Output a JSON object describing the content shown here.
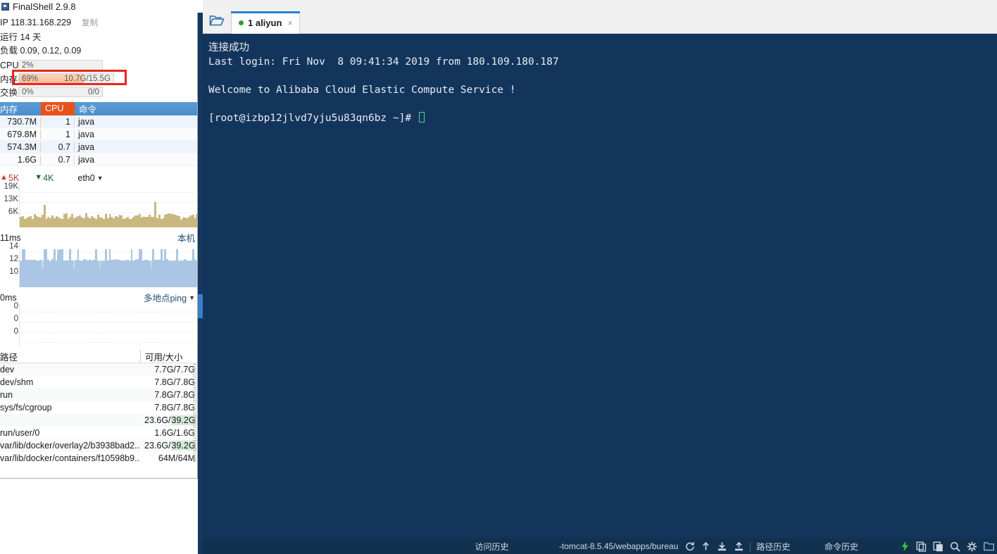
{
  "window": {
    "title": "FinalShell 2.9.8",
    "icon": "finalshell-app-icon"
  },
  "sidebar": {
    "ip_label": "IP 118.31.168.229",
    "copy_label": "复制",
    "uptime": "运行 14 天",
    "load": "负载 0.09, 0.12, 0.09",
    "meters": [
      {
        "name": "cpu",
        "label": "CPU",
        "percent": "2%",
        "value": "",
        "pct_num": 2
      },
      {
        "name": "mem",
        "label": "内存",
        "percent": "69%",
        "value": "10.7G/15.5G",
        "pct_num": 69
      },
      {
        "name": "swap",
        "label": "交换",
        "percent": "0%",
        "value": "0/0",
        "pct_num": 0
      }
    ],
    "highlight_color": "#e8271c",
    "processes": {
      "headers": {
        "mem": "内存",
        "cpu": "CPU",
        "cmd": "命令"
      },
      "rows": [
        {
          "mem": "730.7M",
          "cpu": "1",
          "cmd": "java"
        },
        {
          "mem": "679.8M",
          "cpu": "1",
          "cmd": "java"
        },
        {
          "mem": "574.3M",
          "cpu": "0.7",
          "cmd": "java"
        },
        {
          "mem": "1.6G",
          "cpu": "0.7",
          "cmd": "java"
        }
      ]
    },
    "network": {
      "upload": "5K",
      "download": "4K",
      "interface": "eth0",
      "y_ticks": [
        "19K",
        "13K",
        "6K"
      ]
    },
    "ping": {
      "current": "11ms",
      "source_label": "本机",
      "y_ticks": [
        "14",
        "12",
        "10"
      ]
    },
    "multiping": {
      "current": "0ms",
      "menu_label": "多地点ping",
      "y_ticks": [
        "0",
        "0",
        "0"
      ]
    },
    "disks": {
      "headers": {
        "path": "路径",
        "size": "可用/大小"
      },
      "rows": [
        {
          "path": "dev",
          "avail": "7.7G",
          "total": "7.7G",
          "highlight": false
        },
        {
          "path": "dev/shm",
          "avail": "7.8G",
          "total": "7.8G",
          "highlight": false
        },
        {
          "path": "run",
          "avail": "7.8G",
          "total": "7.8G",
          "highlight": false
        },
        {
          "path": "sys/fs/cgroup",
          "avail": "7.8G",
          "total": "7.8G",
          "highlight": false
        },
        {
          "path": "",
          "avail": "23.6G",
          "total": "39.2G",
          "highlight": true
        },
        {
          "path": "run/user/0",
          "avail": "1.6G",
          "total": "1.6G",
          "highlight": false
        },
        {
          "path": "var/lib/docker/overlay2/b3938bad2...",
          "avail": "23.6G",
          "total": "39.2G",
          "highlight": true
        },
        {
          "path": "var/lib/docker/containers/f10598b9...",
          "avail": "64M",
          "total": "64M",
          "highlight": false
        }
      ]
    }
  },
  "tabbar": {
    "folder_icon": "open-folder-icon",
    "tabs": [
      {
        "label": "1 aliyun",
        "status": "connected",
        "close": "×"
      }
    ]
  },
  "terminal": {
    "lines": [
      "连接成功",
      "Last login: Fri Nov  8 09:41:34 2019 from 180.109.180.187",
      "",
      "Welcome to Alibaba Cloud Elastic Compute Service !",
      "",
      "[root@izbp12jlvd7yju5u83qn6bz ~]# "
    ],
    "background": "#13355c",
    "foreground": "#e8ecf2",
    "cursor_color": "#57d38a"
  },
  "statusbar": {
    "access_history": "访问历史",
    "current_path": "-tomcat-8.5.45/webapps/bureau",
    "path_history": "路径历史",
    "command_history": "命令历史",
    "transfer_icons": [
      "refresh-icon",
      "upload-icon",
      "download-icon",
      "upload-file-icon"
    ],
    "right_icons": [
      "lightning-icon",
      "copy-icon",
      "paste-icon",
      "search-icon",
      "gear-icon",
      "folder-icon"
    ],
    "accent_color": "#2ecc40"
  }
}
